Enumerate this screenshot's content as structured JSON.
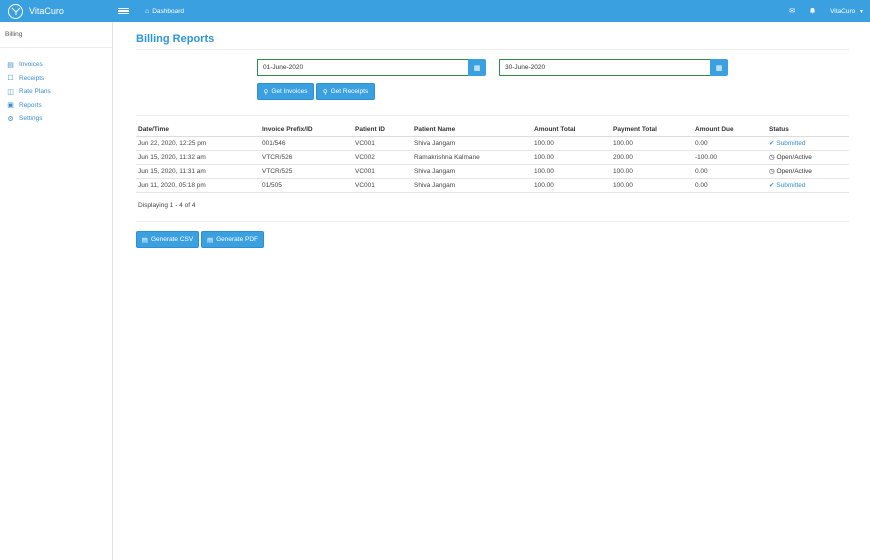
{
  "app": {
    "name": "VitaCuro",
    "logo_icon": "vitacuro-logo-icon"
  },
  "topbar": {
    "dashboard_label": "Dashboard",
    "user_label": "VitaCuro",
    "accent": "#3aa0e0"
  },
  "sidebar": {
    "title": "Billing",
    "items": [
      {
        "label": "Invoices",
        "icon": "invoice-icon"
      },
      {
        "label": "Receipts",
        "icon": "receipt-icon"
      },
      {
        "label": "Rate Plans",
        "icon": "book-icon"
      },
      {
        "label": "Reports",
        "icon": "report-icon"
      },
      {
        "label": "Settings",
        "icon": "gear-icon"
      }
    ]
  },
  "main": {
    "title": "Billing Reports",
    "from_date": "01-June-2020",
    "to_date": "30-June-2020",
    "get_invoices_label": "Get Invoices",
    "get_receipts_label": "Get Receipts",
    "table": {
      "headers": [
        "Date/Time",
        "Invoice Prefix/ID",
        "Patient ID",
        "Patient Name",
        "Amount Total",
        "Payment Total",
        "Amount Due",
        "Status"
      ],
      "rows": [
        [
          "Jun 22, 2020, 12:25 pm",
          "001/546",
          "VC001",
          "Shiva Jangam",
          "100.00",
          "100.00",
          "0.00",
          "Submitted"
        ],
        [
          "Jun 15, 2020, 11:32 am",
          "VTCR/526",
          "VC002",
          "Ramakrishna Kalmane",
          "100.00",
          "200.00",
          "-100.00",
          "Open/Active"
        ],
        [
          "Jun 15, 2020, 11:31 am",
          "VTCR/525",
          "VC001",
          "Shiva Jangam",
          "100.00",
          "100.00",
          "0.00",
          "Open/Active"
        ],
        [
          "Jun 11, 2020, 05:18 pm",
          "01/505",
          "VC001",
          "Shiva Jangam",
          "100.00",
          "100.00",
          "0.00",
          "Submitted"
        ]
      ]
    },
    "displaying_text": "Displaying 1 - 4 of 4",
    "generate_csv_label": "Generate CSV",
    "generate_pdf_label": "Generate PDF"
  }
}
